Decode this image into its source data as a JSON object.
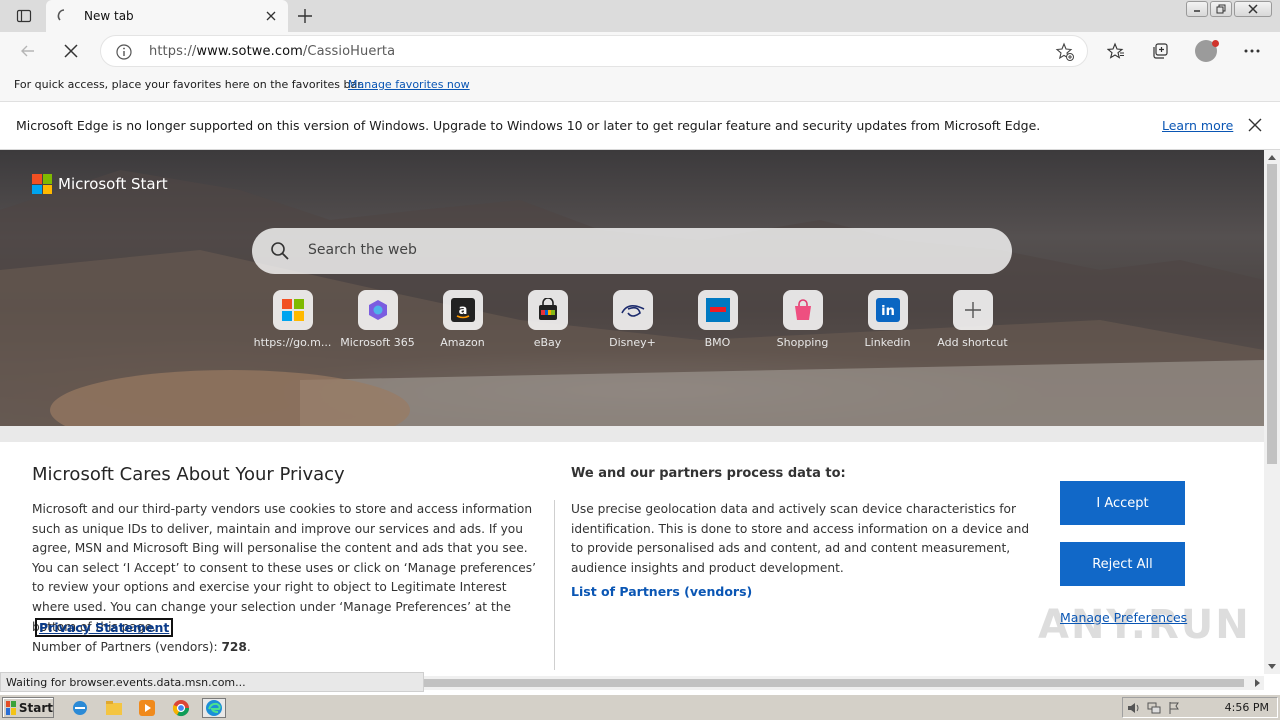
{
  "browser": {
    "tab_title": "New tab",
    "url_prefix": "https://",
    "url_domain": "www.sotwe.com",
    "url_path": "/CassioHuerta"
  },
  "favorites_bar": {
    "text": "For quick access, place your favorites here on the favorites bar.",
    "link": "Manage favorites now"
  },
  "infobar": {
    "message": "Microsoft Edge is no longer supported on this version of Windows. Upgrade to Windows 10 or later to get regular feature and security updates from Microsoft Edge.",
    "learn_more": "Learn more"
  },
  "newtab": {
    "brand": "Microsoft Start",
    "search_placeholder": "Search the web",
    "shortcuts": [
      {
        "label": "https://go.m...",
        "icon": "windows-icon"
      },
      {
        "label": "Microsoft 365",
        "icon": "m365-icon"
      },
      {
        "label": "Amazon",
        "icon": "amazon-icon"
      },
      {
        "label": "eBay",
        "icon": "ebay-icon"
      },
      {
        "label": "Disney+",
        "icon": "disney-icon"
      },
      {
        "label": "BMO",
        "icon": "bmo-icon"
      },
      {
        "label": "Shopping",
        "icon": "shopping-icon"
      },
      {
        "label": "Linkedin",
        "icon": "linkedin-icon"
      },
      {
        "label": "Add shortcut",
        "icon": "plus-icon"
      }
    ]
  },
  "privacy": {
    "title": "Microsoft Cares About Your Privacy",
    "body": "Microsoft and our third-party vendors use cookies to store and access information such as unique IDs to deliver, maintain and improve our services and ads. If you agree, MSN and Microsoft Bing will personalise the content and ads that you see. You can select ‘I Accept’ to consent to these uses or click on ‘Manage preferences’ to review your options and exercise your right to object to Legitimate Interest where used.  You can change your selection under ‘Manage Preferences’ at the bottom of this page.",
    "statement_link": "Privacy Statement",
    "partners_label": "Number of Partners (vendors): ",
    "partners_count": "728",
    "partners_suffix": ".",
    "process_title": "We and our partners process data to:",
    "process_body": "Use precise geolocation data and actively scan device characteristics for identification. This is done to store and access information on a device and to provide personalised ads and content, ad and content measurement, audience insights and product development.",
    "partners_link": "List of Partners (vendors)",
    "accept": "I Accept",
    "reject": "Reject All",
    "manage": "Manage Preferences"
  },
  "watermark": "ANY.RUN",
  "status_text": "Waiting for browser.events.data.msn.com...",
  "taskbar": {
    "start": "Start",
    "clock": "4:56 PM"
  },
  "colors": {
    "accent": "#1168c8",
    "link": "#0a56b4"
  }
}
